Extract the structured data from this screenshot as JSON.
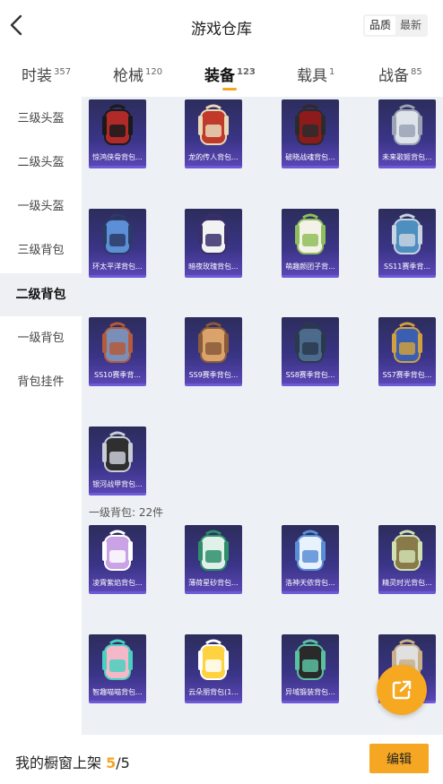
{
  "header": {
    "title": "游戏仓库",
    "back_icon": "chevron-left-icon"
  },
  "sort_toggle": {
    "options": [
      "品质",
      "最新"
    ],
    "selected": "品质"
  },
  "tabs": [
    {
      "label": "时装",
      "count": "357",
      "active": false
    },
    {
      "label": "枪械",
      "count": "120",
      "active": false
    },
    {
      "label": "装备",
      "count": "123",
      "active": true
    },
    {
      "label": "载具",
      "count": "1",
      "active": false
    },
    {
      "label": "战备",
      "count": "85",
      "active": false
    }
  ],
  "sidebar": {
    "items": [
      {
        "label": "三级头盔",
        "active": false
      },
      {
        "label": "二级头盔",
        "active": false
      },
      {
        "label": "一级头盔",
        "active": false
      },
      {
        "label": "三级背包",
        "active": false
      },
      {
        "label": "二级背包",
        "active": true
      },
      {
        "label": "一级背包",
        "active": false
      },
      {
        "label": "背包挂件",
        "active": false
      }
    ]
  },
  "level2_bags": [
    {
      "name": "惊鸿侠骨背包..."
    },
    {
      "name": "龙的传人背包..."
    },
    {
      "name": "破晓战魂背包..."
    },
    {
      "name": "未来歌姬背包..."
    },
    {
      "name": "环太平洋背包..."
    },
    {
      "name": "暗夜玫瑰背包..."
    },
    {
      "name": "萌趣颜团子背..."
    },
    {
      "name": "SS11赛季背..."
    },
    {
      "name": "SS10赛季背..."
    },
    {
      "name": "SS9赛季背包..."
    },
    {
      "name": "SS8赛季背包..."
    },
    {
      "name": "SS7赛季背包..."
    },
    {
      "name": "银河战甲背包..."
    }
  ],
  "level1_section": {
    "label": "一级背包: 22件"
  },
  "level1_bags": [
    {
      "name": "凌霄紫焰背包..."
    },
    {
      "name": "薄荷星砂背包..."
    },
    {
      "name": "洛神天依背包..."
    },
    {
      "name": "精灵时光背包..."
    },
    {
      "name": "智趣喵喵背包..."
    },
    {
      "name": "云朵朋背包(1..."
    },
    {
      "name": "异域锻装背包..."
    },
    {
      "name": ""
    }
  ],
  "footer": {
    "label": "我的橱窗上架",
    "current": "5",
    "separator": "/",
    "total": "5",
    "edit_label": "编辑"
  },
  "fab": {
    "icon": "share-external-icon"
  },
  "colors": {
    "accent": "#f5a623",
    "card_bg": "#3a3486",
    "content_bg": "#edf0f4"
  }
}
